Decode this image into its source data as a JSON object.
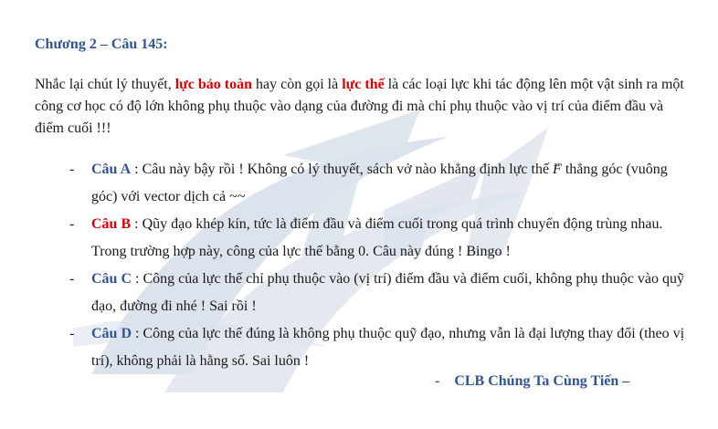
{
  "heading": "Chương 2 – Câu 145:",
  "intro": {
    "t1": "Nhắc lại chút lý thuyết, ",
    "hl1": "lực bảo toàn",
    "t2": " hay còn gọi là ",
    "hl2": "lực thế",
    "t3": " là các loại lực khi tác động lên một vật sinh ra một công cơ học có độ lớn không phụ thuộc vào dạng của đường đi mà chỉ phụ thuộc vào vị trí của điểm đầu và điểm cuối !!!"
  },
  "items": [
    {
      "dash": "-",
      "label": "Câu A",
      "text_a": " : Câu này bậy rồi ! Không có lý thuyết, sách vở nào khẳng định lực thế ",
      "vector": "F",
      "text_b": " thẳng góc (vuông góc) với vector dịch cả ~~"
    },
    {
      "dash": "-",
      "label": "Câu B",
      "text": " : Qũy đạo khép kín, tức là điểm đầu và điểm cuối trong quá trình chuyển động trùng nhau. Trong trường hợp này, công của lực thế bằng 0. Câu này đúng ! Bingo !"
    },
    {
      "dash": "-",
      "label": "Câu C",
      "text": " : Công của lực thế chỉ phụ thuộc vào (vị trí) điểm đầu và điểm cuối, không phụ thuộc vào quỹ đạo, đường đi nhé ! Sai rồi !"
    },
    {
      "dash": "-",
      "label": "Câu D",
      "text": " : Công của lực thế đúng là không phụ thuộc quỹ đạo, nhưng vẫn là đại lượng thay đổi (theo vị trí), không phải là hằng số. Sai luôn !"
    }
  ],
  "footer": {
    "dash": "-",
    "text": "CLB Chúng Ta Cùng Tiến –"
  },
  "colors": {
    "heading": "#2f5597",
    "highlight_red": "#e00000",
    "watermark": "#dde3ec"
  }
}
